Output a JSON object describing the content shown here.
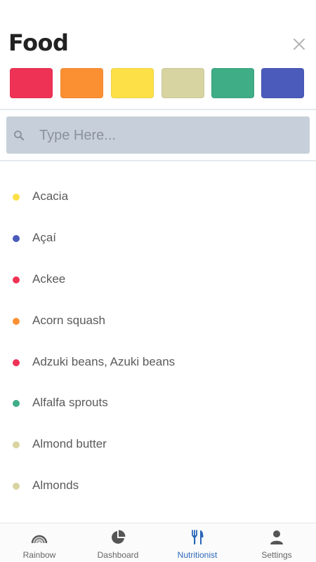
{
  "header": {
    "title": "Food",
    "close_icon": "close-icon"
  },
  "color_filters": [
    {
      "name": "red",
      "color": "#ee3256"
    },
    {
      "name": "orange",
      "color": "#fb9033"
    },
    {
      "name": "yellow",
      "color": "#fde047"
    },
    {
      "name": "beige",
      "color": "#d8d4a2"
    },
    {
      "name": "green",
      "color": "#3fad86"
    },
    {
      "name": "blue",
      "color": "#4a5bbb"
    }
  ],
  "search": {
    "placeholder": "Type Here...",
    "value": "",
    "icon": "search-icon"
  },
  "foods": [
    {
      "label": "Acacia",
      "color": "#fde047"
    },
    {
      "label": "Açaí",
      "color": "#4a5bbb"
    },
    {
      "label": "Ackee",
      "color": "#ee3256"
    },
    {
      "label": "Acorn squash",
      "color": "#fb9033"
    },
    {
      "label": "Adzuki beans, Azuki beans",
      "color": "#ee3256"
    },
    {
      "label": "Alfalfa sprouts",
      "color": "#3fad86"
    },
    {
      "label": "Almond butter",
      "color": "#d8d4a2"
    },
    {
      "label": "Almonds",
      "color": "#d8d4a2"
    }
  ],
  "tabs": [
    {
      "label": "Rainbow",
      "icon": "rainbow-icon",
      "active": false
    },
    {
      "label": "Dashboard",
      "icon": "pie-chart-icon",
      "active": false
    },
    {
      "label": "Nutritionist",
      "icon": "utensils-icon",
      "active": true
    },
    {
      "label": "Settings",
      "icon": "person-icon",
      "active": false
    }
  ],
  "colors": {
    "active_tab": "#2c67b9",
    "inactive_tab": "#666666",
    "search_bg": "#c7d0da"
  }
}
